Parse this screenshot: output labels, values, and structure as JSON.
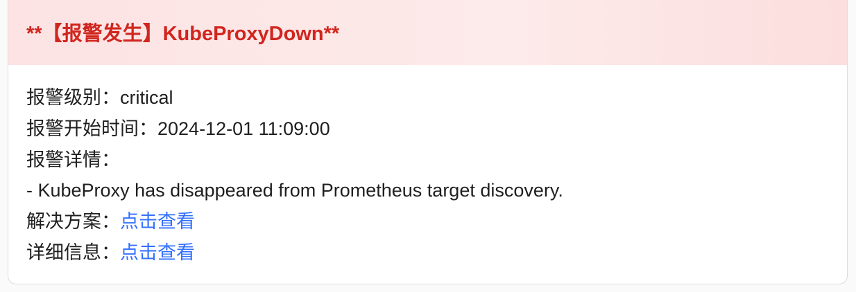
{
  "alert": {
    "title": "**【报警发生】KubeProxyDown**",
    "level_label": "报警级别：",
    "level_value": "critical",
    "start_label": "报警开始时间：",
    "start_value": "2024-12-01 11:09:00",
    "detail_label": "报警详情：",
    "detail_text": "- KubeProxy has disappeared from Prometheus target discovery.",
    "solution_label": "解决方案：",
    "solution_link": "点击查看",
    "info_label": "详细信息：",
    "info_link": "点击查看"
  },
  "colors": {
    "title": "#d0261f",
    "header_bg": "#fde3e3",
    "link": "#3370ff"
  }
}
